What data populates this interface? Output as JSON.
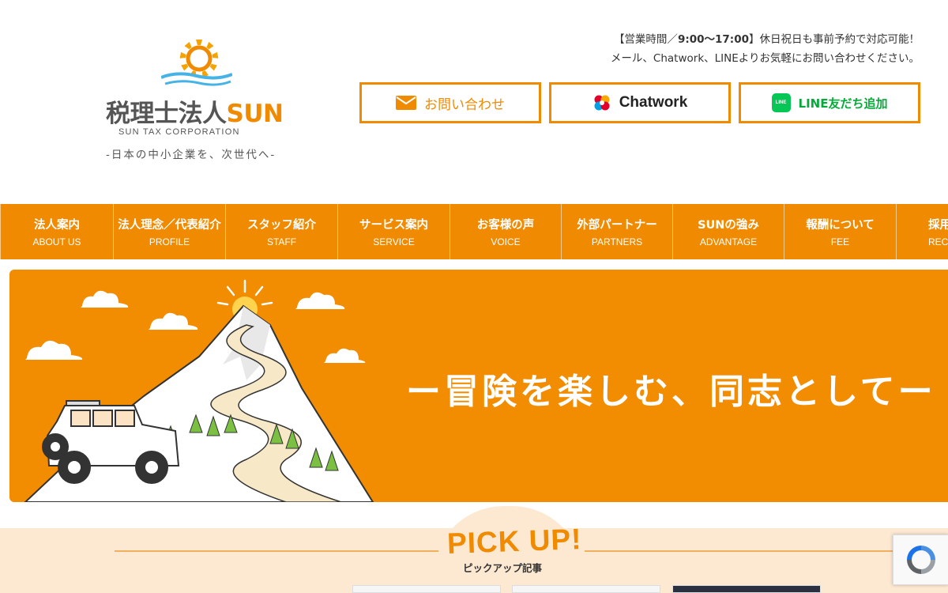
{
  "header": {
    "logo_name_jp": "税理士法人",
    "logo_name_accent": "SUN",
    "logo_corp": "SUN TAX CORPORATION",
    "logo_tagline": "-日本の中小企業を、次世代へ-",
    "hours_prefix": "【営業時間／",
    "hours_time": "9:00〜17:00",
    "hours_suffix": "】休日祝日も事前予約で対応可能！",
    "contact_note": "メール、Chatwork、LINEよりお気軽にお問い合わせください。",
    "cta_mail_label": "お問い合わせ",
    "cta_chatwork_label": "Chatwork",
    "cta_line_label": "LINE友だち追加",
    "line_icon_text": "LINE"
  },
  "nav": {
    "items": [
      {
        "jp": "法人案内",
        "en": "ABOUT US"
      },
      {
        "jp": "法人理念／代表紹介",
        "en": "PROFILE"
      },
      {
        "jp": "スタッフ紹介",
        "en": "STAFF"
      },
      {
        "jp": "サービス案内",
        "en": "SERVICE"
      },
      {
        "jp": "お客様の声",
        "en": "VOICE"
      },
      {
        "jp": "外部パートナー",
        "en": "PARTNERS"
      },
      {
        "jp": "SUNの強み",
        "en": "ADVANTAGE"
      },
      {
        "jp": "報酬について",
        "en": "FEE"
      },
      {
        "jp": "採用",
        "en": "RECRUIT"
      }
    ]
  },
  "hero": {
    "headline": "ー冒険を楽しむ、同志としてー"
  },
  "pickup": {
    "title": "PICK UP!",
    "subtitle": "ピックアップ記事"
  },
  "colors": {
    "brand_orange": "#f08a00",
    "line_green": "#06c755",
    "pickup_bg": "#fde9d2"
  },
  "icons": [
    "mail-icon",
    "chatwork-icon",
    "line-icon",
    "recaptcha-icon"
  ]
}
